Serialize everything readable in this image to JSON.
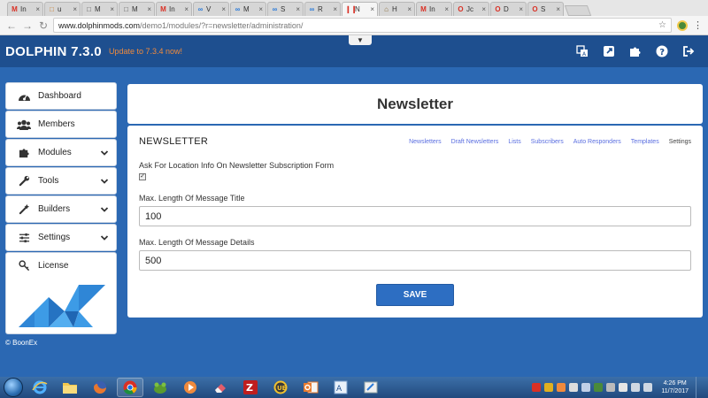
{
  "browser": {
    "tabs": [
      {
        "label": "In",
        "icon": "gmail-icon",
        "color": "#d93025",
        "active": false
      },
      {
        "label": "u",
        "icon": "page-icon",
        "color": "#c97a2a",
        "active": false
      },
      {
        "label": "M",
        "icon": "page-icon",
        "color": "#555555",
        "active": false
      },
      {
        "label": "M",
        "icon": "page-icon",
        "color": "#555555",
        "active": false
      },
      {
        "label": "In",
        "icon": "gmail-icon",
        "color": "#d93025",
        "active": false
      },
      {
        "label": "V",
        "icon": "infinity-icon",
        "color": "#2b7bd8",
        "active": false
      },
      {
        "label": "M",
        "icon": "infinity-icon",
        "color": "#2b7bd8",
        "active": false
      },
      {
        "label": "S",
        "icon": "infinity-icon",
        "color": "#2b7bd8",
        "active": false
      },
      {
        "label": "R",
        "icon": "infinity-icon",
        "color": "#2b7bd8",
        "active": false
      },
      {
        "label": "N",
        "icon": "pause-icon",
        "color": "#d93025",
        "active": true
      },
      {
        "label": "H",
        "icon": "house-icon",
        "color": "#8a6d3b",
        "active": false
      },
      {
        "label": "In",
        "icon": "gmail-icon",
        "color": "#d93025",
        "active": false
      },
      {
        "label": "Jc",
        "icon": "opera-icon",
        "color": "#d93025",
        "active": false
      },
      {
        "label": "D",
        "icon": "opera-icon",
        "color": "#d93025",
        "active": false
      },
      {
        "label": "S",
        "icon": "opera-icon",
        "color": "#d93025",
        "active": false
      }
    ],
    "url_host": "www.dolphinmods.com",
    "url_path": "/demo1/modules/?r=newsletter/administration/"
  },
  "header": {
    "brand": "DOLPHIN 7.3.0",
    "update_text": "Update to 7.3.4 now!",
    "icons": [
      "translate-icon",
      "external-link-icon",
      "puzzle-icon",
      "help-icon",
      "logout-icon"
    ]
  },
  "sidebar": {
    "items": [
      {
        "label": "Dashboard",
        "icon": "dashboard-icon",
        "expandable": false
      },
      {
        "label": "Members",
        "icon": "members-icon",
        "expandable": false
      },
      {
        "label": "Modules",
        "icon": "puzzle-icon",
        "expandable": true
      },
      {
        "label": "Tools",
        "icon": "wrench-icon",
        "expandable": true
      },
      {
        "label": "Builders",
        "icon": "magic-wand-icon",
        "expandable": true
      },
      {
        "label": "Settings",
        "icon": "sliders-icon",
        "expandable": true
      }
    ],
    "license_label": "License",
    "copyright": "© BoonEx"
  },
  "page": {
    "title": "Newsletter",
    "section_title": "NEWSLETTER",
    "subnav": [
      "Newsletters",
      "Draft Newsletters",
      "Lists",
      "Subscribers",
      "Auto Responders",
      "Templates",
      "Settings"
    ],
    "current_subnav": "Settings",
    "fields": {
      "location_label": "Ask For Location Info On Newsletter Subscription Form",
      "location_checked": true,
      "title_length_label": "Max. Length Of Message Title",
      "title_length_value": "100",
      "details_length_label": "Max. Length Of Message Details",
      "details_length_value": "500"
    },
    "save_label": "SAVE"
  },
  "taskbar": {
    "time": "4:26 PM",
    "date": "11/7/2017"
  },
  "colors": {
    "page_bg": "#2b68b3",
    "header_bg": "#1e4f8f",
    "accent": "#2d6ec2",
    "update_orange": "#f08a3c",
    "link": "#5a6ee0"
  }
}
